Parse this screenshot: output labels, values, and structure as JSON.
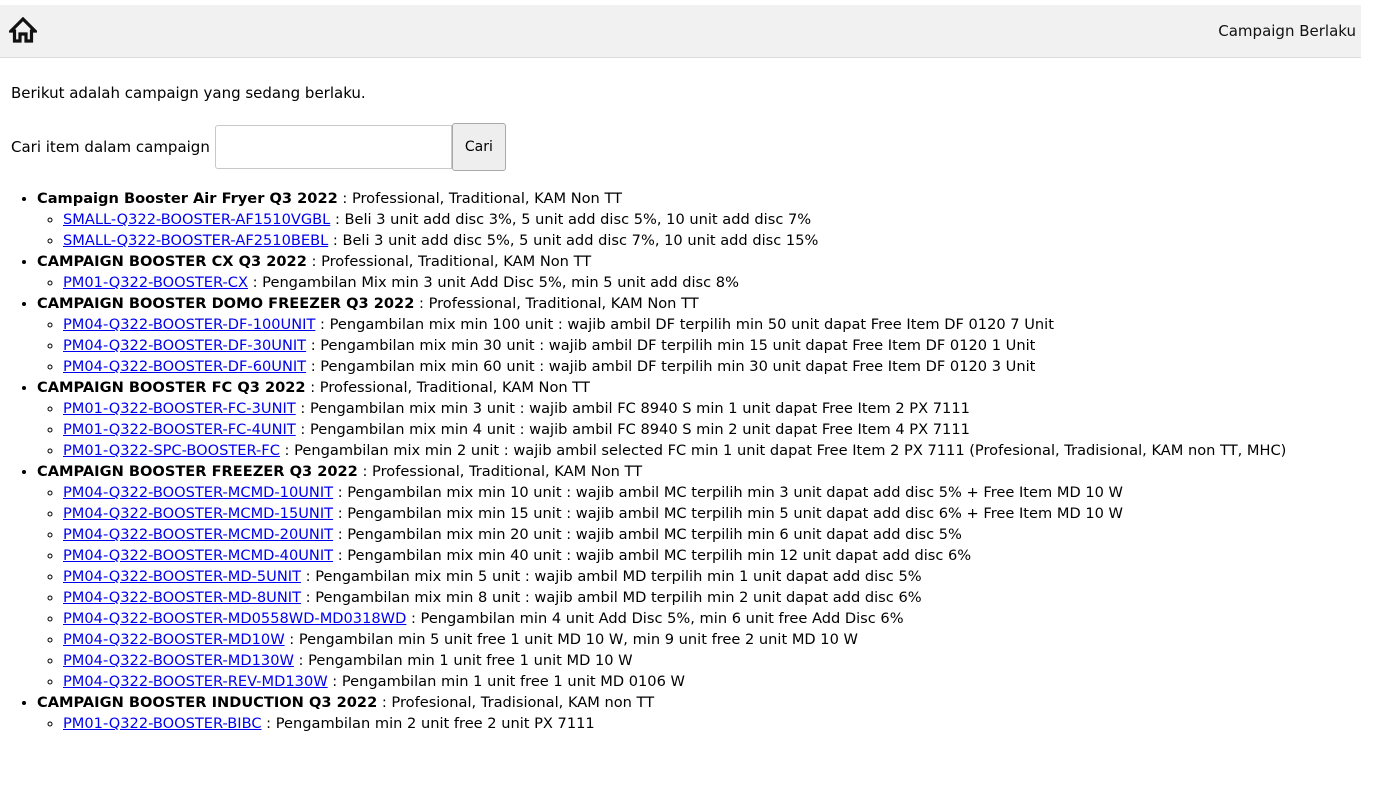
{
  "header": {
    "home_icon": "home-icon",
    "title": "Campaign Berlaku"
  },
  "intro_text": "Berikut adalah campaign yang sedang berlaku.",
  "search": {
    "label": "Cari item dalam campaign",
    "value": "",
    "placeholder": "",
    "button_label": "Cari"
  },
  "campaigns": [
    {
      "name": "Campaign Booster Air Fryer Q3 2022",
      "segments": " : Professional, Traditional, KAM Non TT",
      "items": [
        {
          "code": "SMALL-Q322-BOOSTER-AF1510VGBL",
          "desc": " : Beli 3 unit add disc 3%, 5 unit add disc 5%, 10 unit add disc 7%"
        },
        {
          "code": "SMALL-Q322-BOOSTER-AF2510BEBL",
          "desc": " : Beli 3 unit add disc 5%, 5 unit add disc 7%, 10 unit add disc 15%"
        }
      ]
    },
    {
      "name": "CAMPAIGN BOOSTER CX Q3 2022",
      "segments": " : Professional, Traditional, KAM Non TT",
      "items": [
        {
          "code": "PM01-Q322-BOOSTER-CX",
          "desc": " : Pengambilan Mix min 3 unit Add Disc 5%, min 5 unit add disc 8%"
        }
      ]
    },
    {
      "name": "CAMPAIGN BOOSTER DOMO FREEZER Q3 2022",
      "segments": " : Professional, Traditional, KAM Non TT",
      "items": [
        {
          "code": "PM04-Q322-BOOSTER-DF-100UNIT",
          "desc": " : Pengambilan mix min 100 unit : wajib ambil DF terpilih min 50 unit dapat Free Item DF 0120 7 Unit"
        },
        {
          "code": "PM04-Q322-BOOSTER-DF-30UNIT",
          "desc": " : Pengambilan mix min 30 unit : wajib ambil DF terpilih min 15 unit dapat Free Item DF 0120 1 Unit"
        },
        {
          "code": "PM04-Q322-BOOSTER-DF-60UNIT",
          "desc": " : Pengambilan mix min 60 unit : wajib ambil DF terpilih min 30 unit dapat Free Item DF 0120 3 Unit"
        }
      ]
    },
    {
      "name": "CAMPAIGN BOOSTER FC Q3 2022",
      "segments": " : Professional, Traditional, KAM Non TT",
      "items": [
        {
          "code": "PM01-Q322-BOOSTER-FC-3UNIT",
          "desc": " : Pengambilan mix min 3 unit : wajib ambil FC 8940 S min 1 unit dapat Free Item 2 PX 7111"
        },
        {
          "code": "PM01-Q322-BOOSTER-FC-4UNIT",
          "desc": " : Pengambilan mix min 4 unit : wajib ambil FC 8940 S min 2 unit dapat Free Item 4 PX 7111"
        },
        {
          "code": "PM01-Q322-SPC-BOOSTER-FC",
          "desc": " : Pengambilan mix min 2 unit : wajib ambil selected FC min 1 unit dapat Free Item 2 PX 7111 (Profesional, Tradisional, KAM non TT, MHC)"
        }
      ]
    },
    {
      "name": "CAMPAIGN BOOSTER FREEZER Q3 2022",
      "segments": " : Professional, Traditional, KAM Non TT",
      "items": [
        {
          "code": "PM04-Q322-BOOSTER-MCMD-10UNIT",
          "desc": " : Pengambilan mix min 10 unit : wajib ambil MC terpilih min 3 unit dapat add disc 5% + Free Item MD 10 W"
        },
        {
          "code": "PM04-Q322-BOOSTER-MCMD-15UNIT",
          "desc": " : Pengambilan mix min 15 unit : wajib ambil MC terpilih min 5 unit dapat add disc 6% + Free Item MD 10 W"
        },
        {
          "code": "PM04-Q322-BOOSTER-MCMD-20UNIT",
          "desc": " : Pengambilan mix min 20 unit : wajib ambil MC terpilih min 6 unit dapat add disc 5%"
        },
        {
          "code": "PM04-Q322-BOOSTER-MCMD-40UNIT",
          "desc": " : Pengambilan mix min 40 unit : wajib ambil MC terpilih min 12 unit dapat add disc 6%"
        },
        {
          "code": "PM04-Q322-BOOSTER-MD-5UNIT",
          "desc": " : Pengambilan mix min 5 unit : wajib ambil MD terpilih min 1 unit dapat add disc 5%"
        },
        {
          "code": "PM04-Q322-BOOSTER-MD-8UNIT",
          "desc": " : Pengambilan mix min 8 unit : wajib ambil MD terpilih min 2 unit dapat add disc 6%"
        },
        {
          "code": "PM04-Q322-BOOSTER-MD0558WD-MD0318WD",
          "desc": " : Pengambilan min 4 unit Add Disc 5%, min 6 unit free Add Disc 6%"
        },
        {
          "code": "PM04-Q322-BOOSTER-MD10W",
          "desc": " : Pengambilan min 5 unit free 1 unit MD 10 W, min 9 unit free 2 unit MD 10 W"
        },
        {
          "code": "PM04-Q322-BOOSTER-MD130W",
          "desc": " : Pengambilan min 1 unit free 1 unit MD 10 W"
        },
        {
          "code": "PM04-Q322-BOOSTER-REV-MD130W",
          "desc": " : Pengambilan min 1 unit free 1 unit MD 0106 W"
        }
      ]
    },
    {
      "name": "CAMPAIGN BOOSTER INDUCTION Q3 2022",
      "segments": " : Profesional, Tradisional, KAM non TT",
      "items": [
        {
          "code": "PM01-Q322-BOOSTER-BIBC",
          "desc": " : Pengambilan min 2 unit free 2 unit PX 7111"
        }
      ]
    }
  ]
}
